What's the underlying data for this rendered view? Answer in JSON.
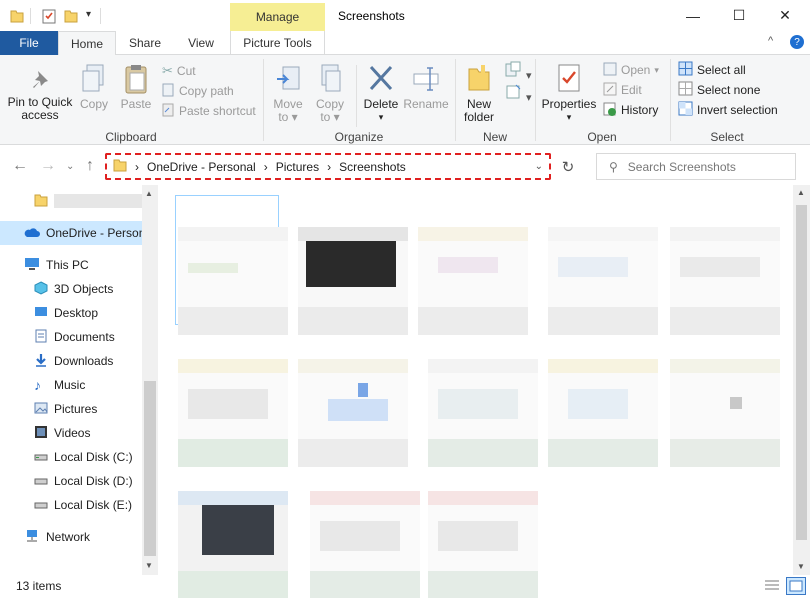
{
  "window": {
    "title": "Screenshots",
    "manage_label": "Manage",
    "minimize": "—",
    "maximize": "☐",
    "close": "✕"
  },
  "tabs": {
    "file": "File",
    "home": "Home",
    "share": "Share",
    "view": "View",
    "picture_tools": "Picture Tools",
    "collapse": "^",
    "help": "?"
  },
  "ribbon": {
    "clipboard": {
      "label": "Clipboard",
      "pin": "Pin to Quick access",
      "pin_line1": "Pin to Quick",
      "pin_line2": "access",
      "copy": "Copy",
      "paste": "Paste",
      "cut": "Cut",
      "copy_path": "Copy path",
      "paste_shortcut": "Paste shortcut"
    },
    "organize": {
      "label": "Organize",
      "move_to": "Move",
      "move_to_2": "to",
      "copy_to": "Copy",
      "copy_to_2": "to",
      "delete": "Delete",
      "rename": "Rename"
    },
    "new": {
      "label": "New",
      "new_folder_1": "New",
      "new_folder_2": "folder"
    },
    "open": {
      "label": "Open",
      "properties": "Properties",
      "open": "Open",
      "edit": "Edit",
      "history": "History"
    },
    "select": {
      "label": "Select",
      "select_all": "Select all",
      "select_none": "Select none",
      "invert": "Invert selection"
    }
  },
  "address": {
    "crumbs": [
      "OneDrive - Personal",
      "Pictures",
      "Screenshots"
    ],
    "search_placeholder": "Search Screenshots"
  },
  "navpane": {
    "items": [
      {
        "label": "",
        "icon": "folder-icon"
      },
      {
        "label": "OneDrive - Personal",
        "icon": "cloud-icon"
      },
      {
        "label": "This PC",
        "icon": "pc-icon"
      },
      {
        "label": "3D Objects",
        "icon": "cube-icon"
      },
      {
        "label": "Desktop",
        "icon": "desktop-icon"
      },
      {
        "label": "Documents",
        "icon": "documents-icon"
      },
      {
        "label": "Downloads",
        "icon": "downloads-icon"
      },
      {
        "label": "Music",
        "icon": "music-icon"
      },
      {
        "label": "Pictures",
        "icon": "pictures-icon"
      },
      {
        "label": "Videos",
        "icon": "videos-icon"
      },
      {
        "label": "Local Disk (C:)",
        "icon": "drive-icon"
      },
      {
        "label": "Local Disk (D:)",
        "icon": "drive-icon"
      },
      {
        "label": "Local Disk (E:)",
        "icon": "drive-icon"
      },
      {
        "label": "Network",
        "icon": "network-icon"
      }
    ]
  },
  "status": {
    "count": "13 items"
  },
  "colors": {
    "file_tab": "#1f5aa0",
    "manage_tab": "#f6ee94",
    "address_highlight": "#e02020",
    "selection": "#cce8ff"
  }
}
